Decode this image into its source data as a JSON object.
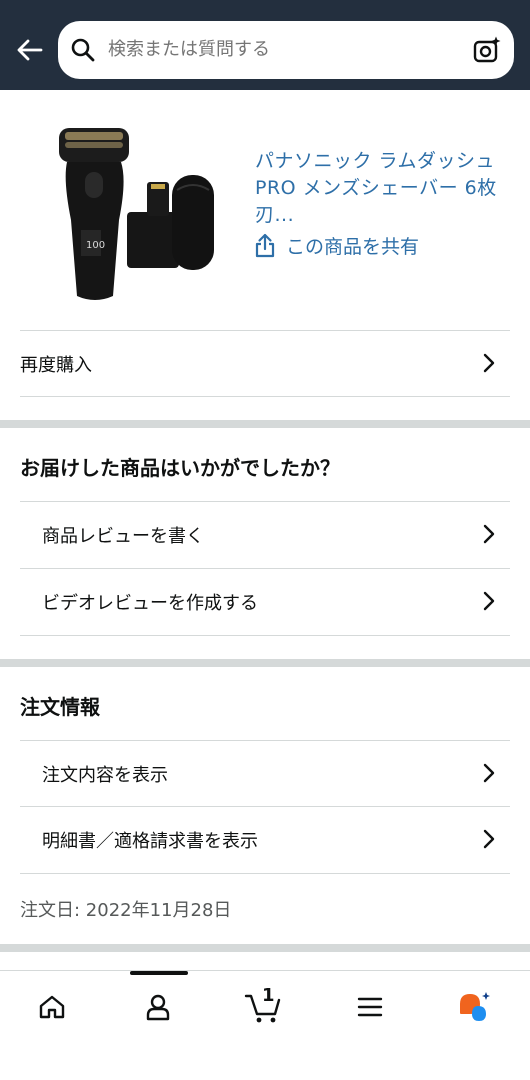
{
  "header": {
    "search_placeholder": "検索または質問する"
  },
  "product": {
    "title": "パナソニック ラムダッシュPRO メンズシェーバー 6枚刃...",
    "share_label": "この商品を共有"
  },
  "buy_again": {
    "label": "再度購入"
  },
  "review_section": {
    "title": "お届けした商品はいかがでしたか？",
    "items": [
      {
        "label": "商品レビューを書く"
      },
      {
        "label": "ビデオレビューを作成する"
      }
    ]
  },
  "order_section": {
    "title": "注文情報",
    "items": [
      {
        "label": "注文内容を表示"
      },
      {
        "label": "明細書／適格請求書を表示"
      }
    ],
    "order_date": "注文日: 2022年11月28日"
  },
  "bottom_nav": {
    "cart_count": "1",
    "active_tab": "account"
  },
  "colors": {
    "header_bg": "#232f3e",
    "link": "#2e6fa8",
    "divider": "#d5d9d9",
    "assistant_orange": "#f0641e",
    "assistant_blue": "#1e8ef0"
  }
}
